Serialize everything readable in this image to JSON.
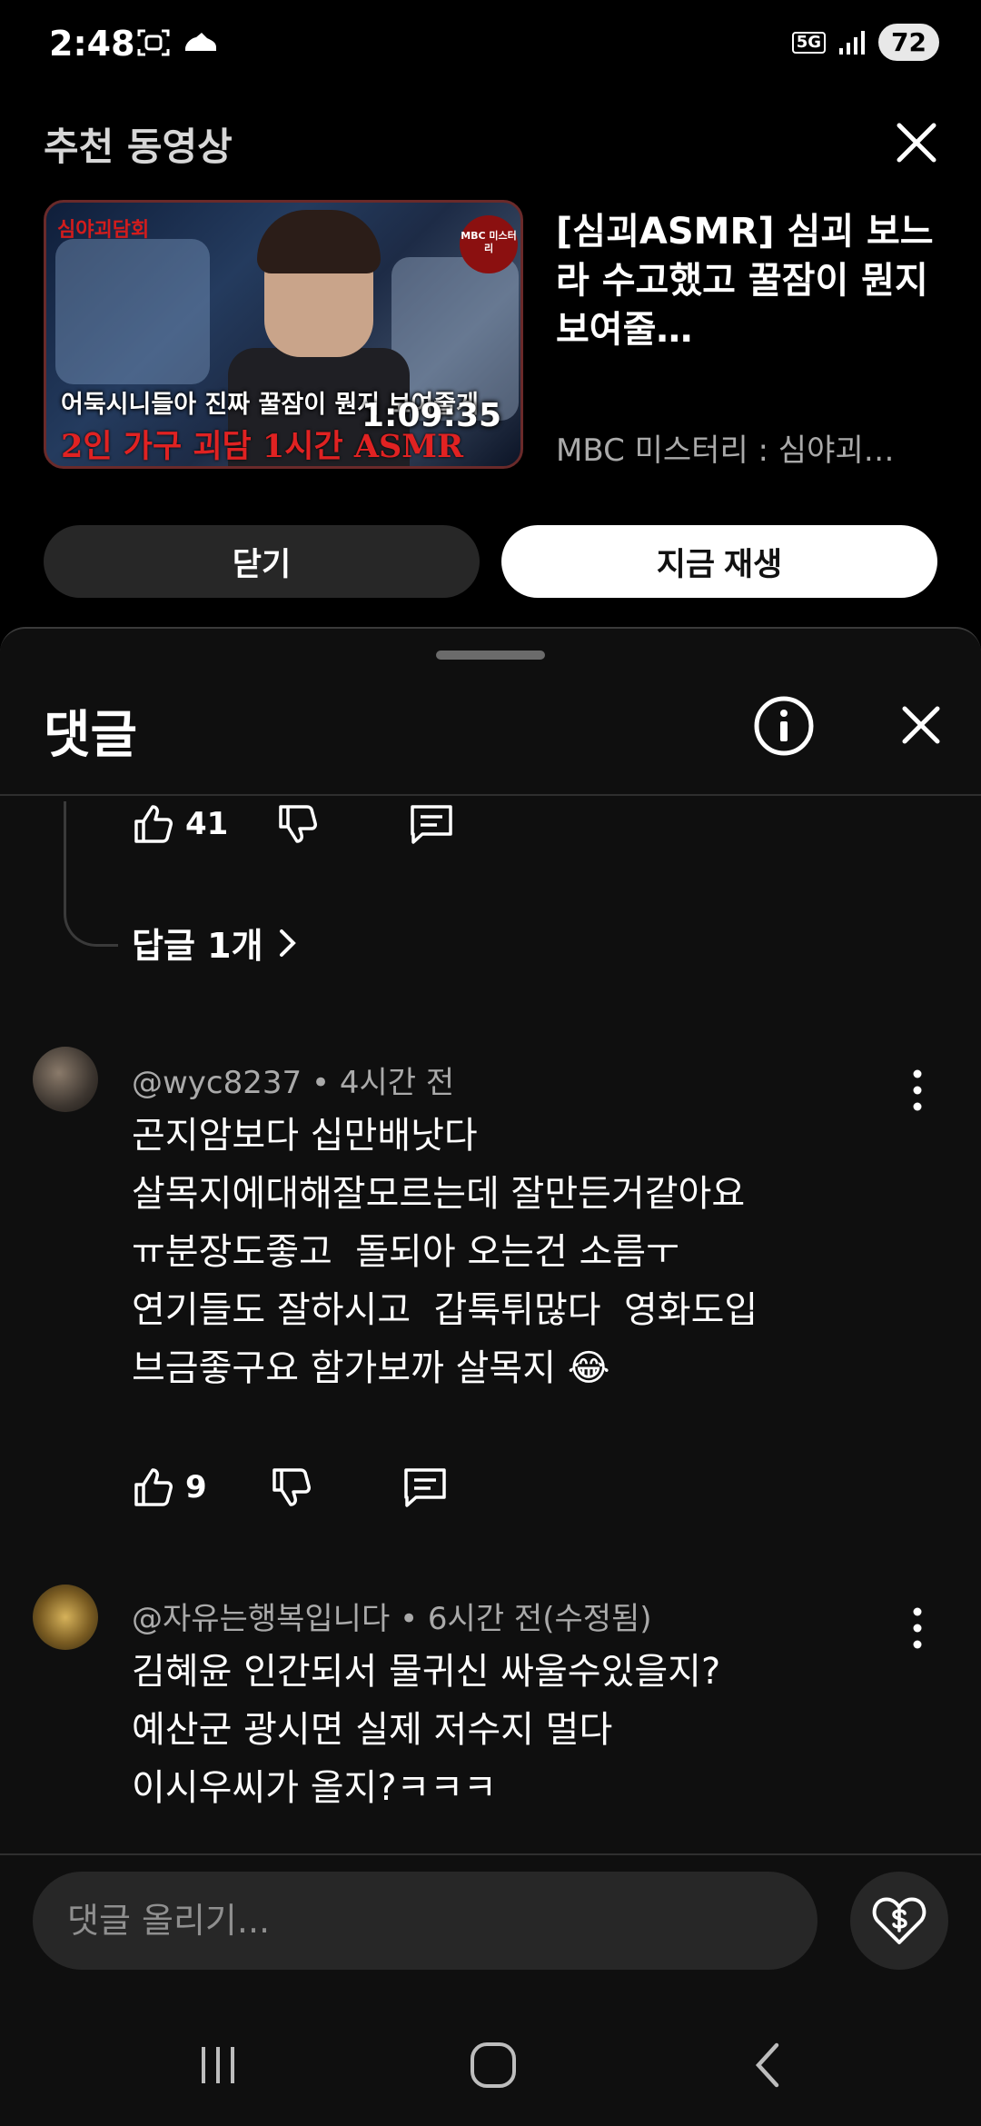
{
  "status_bar": {
    "time": "2:48",
    "network": "5G",
    "battery": "72"
  },
  "recommended": {
    "header": "추천 동영상",
    "video": {
      "title": "[심괴ASMR] 심괴 보느라 수고했고 꿀잠이 뭔지 보여줄…",
      "channel": "MBC 미스터리 : 심야괴…",
      "duration": "1:09:35",
      "thumbnail_text_top": "어둑시니들아 진짜 꿀잠이 뭔지 보여줄게",
      "thumbnail_text_bottom": "2인 가구 괴담 1시간 ASMR",
      "thumbnail_corner": "심야괴담회",
      "thumbnail_logo": "MBC 미스터리"
    },
    "dismiss_label": "닫기",
    "play_label": "지금 재생"
  },
  "comments": {
    "title": "댓글",
    "prev_comment": {
      "likes": "41",
      "replies_label": "답글 1개"
    },
    "items": [
      {
        "author": "@wyc8237",
        "time": "• 4시간 전",
        "lines": [
          "곤지암보다 십만배낫다",
          "살목지에대해잘모르는데 잘만든거같아요",
          "ㅠ분장도좋고  돌되아 오는건 소름ㅜ",
          "연기들도 잘하시고  갑툭튀많다  영화도입",
          "브금좋구요 함가보까 살목지 😂"
        ],
        "likes": "9"
      },
      {
        "author": "@자유는행복입니다",
        "time": "• 6시간 전(수정됨)",
        "lines": [
          "김혜윤 인간되서 물귀신 싸울수있을지?",
          "예산군 광시면 실제 저수지 멀다",
          "이시우씨가 올지?ㅋㅋㅋ"
        ]
      }
    ],
    "input_placeholder": "댓글 올리기..."
  },
  "icons": {
    "like": "thumbs-up-icon",
    "dislike": "thumbs-down-icon",
    "reply": "comment-bubble-icon",
    "more": "kebab-menu-icon",
    "info": "info-icon",
    "close": "close-icon",
    "thanks": "heart-dollar-icon"
  },
  "colors": {
    "background": "#0f0f0f",
    "surface": "#272727",
    "text_secondary": "#aaaaaa",
    "primary_button": "#ffffff"
  }
}
